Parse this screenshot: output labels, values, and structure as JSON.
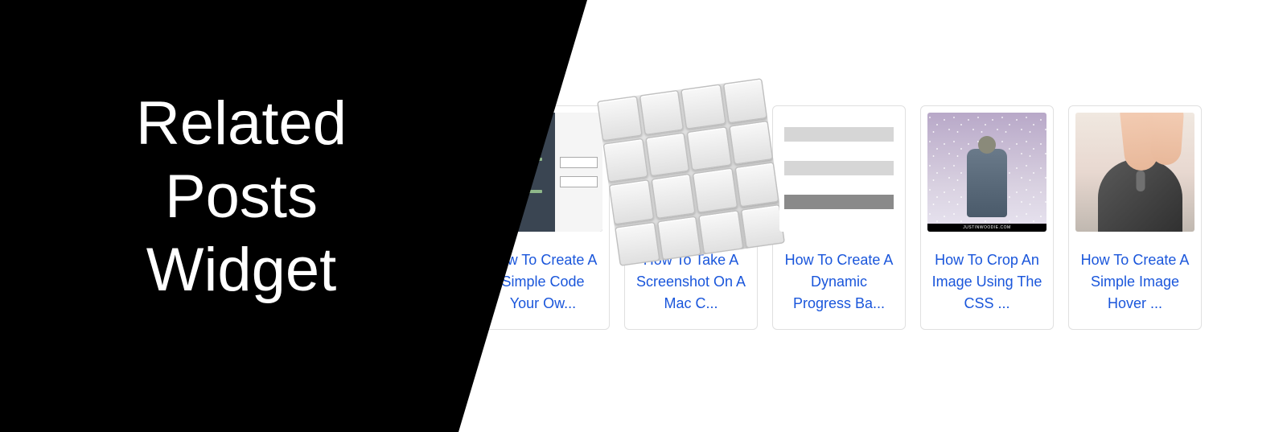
{
  "overlay": {
    "title": "Related Posts Widget"
  },
  "posts": [
    {
      "title": "How To Create A Simple Code Your Ow..."
    },
    {
      "title": "How To Take A Screenshot On A Mac C..."
    },
    {
      "title": "How To Create A Dynamic Progress Ba..."
    },
    {
      "title": "How To Crop An Image Using The CSS ..."
    },
    {
      "title": "How To Create A Simple Image Hover ..."
    }
  ],
  "watermark": "JUSTINWOODIE.COM"
}
